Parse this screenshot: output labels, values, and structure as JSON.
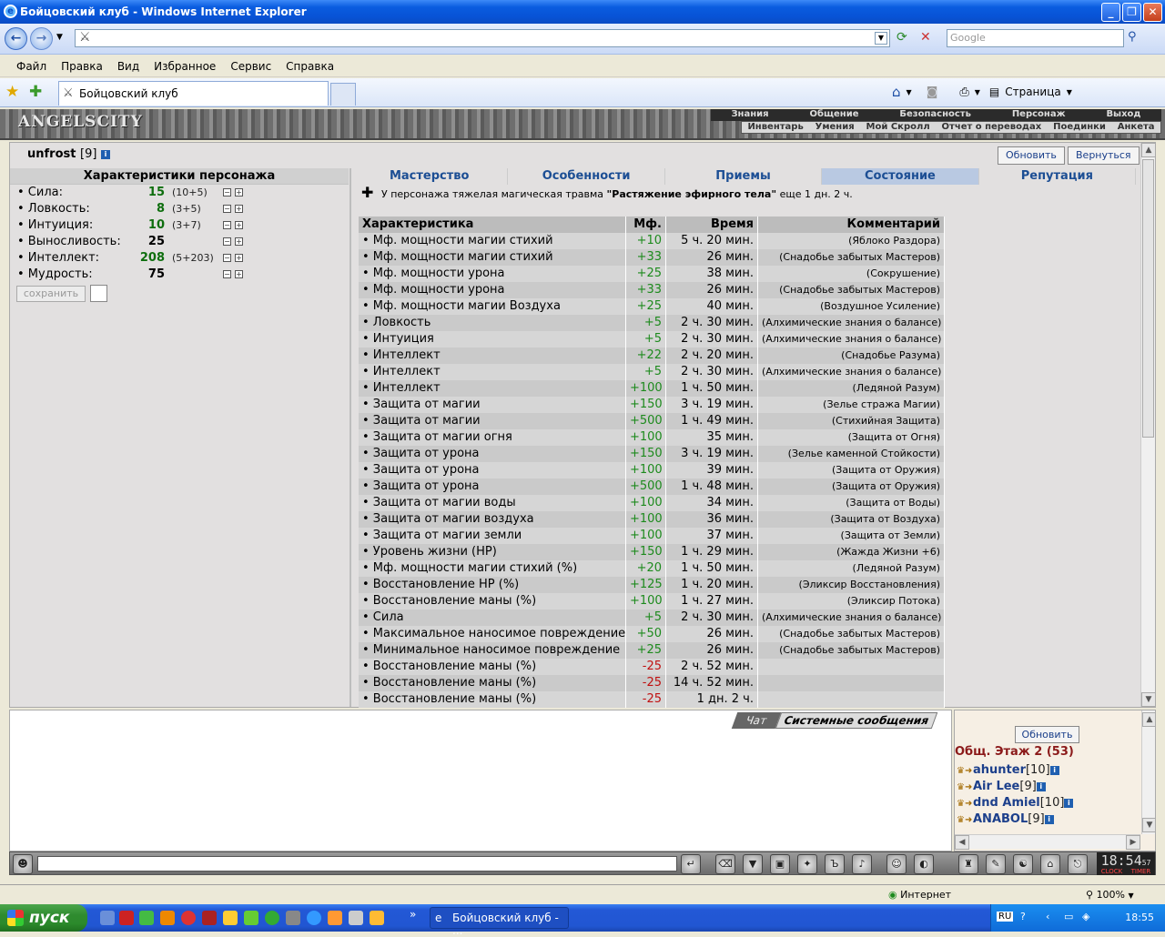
{
  "window": {
    "title": "Бойцовский клуб - Windows Internet Explorer"
  },
  "search": {
    "placeholder": "Google"
  },
  "menu": [
    "Файл",
    "Правка",
    "Вид",
    "Избранное",
    "Сервис",
    "Справка"
  ],
  "tab": {
    "title": "Бойцовский клуб",
    "page_label": "Страница"
  },
  "site": {
    "logo": "ANGELSCITY",
    "topnav": [
      "Знания",
      "Общение",
      "Безопасность",
      "Персонаж",
      "Выход"
    ],
    "subnav": [
      "Инвентарь",
      "Умения",
      "Мой Скролл",
      "Отчет о переводах",
      "Поединки",
      "Анкета"
    ]
  },
  "character": {
    "name": "unfrost",
    "level": "[9]"
  },
  "buttons": {
    "refresh": "Обновить",
    "back": "Вернуться",
    "save": "сохранить",
    "roster_refresh": "Обновить"
  },
  "stats": {
    "title": "Характеристики персонажа",
    "items": [
      {
        "name": "• Сила:",
        "value": "15",
        "base": "(10+5)",
        "green": true
      },
      {
        "name": "• Ловкость:",
        "value": "8",
        "base": "(3+5)",
        "green": true
      },
      {
        "name": "• Интуиция:",
        "value": "10",
        "base": "(3+7)",
        "green": true
      },
      {
        "name": "• Выносливость:",
        "value": "25",
        "base": "",
        "green": false
      },
      {
        "name": "• Интеллект:",
        "value": "208",
        "base": "(5+203)",
        "green": true
      },
      {
        "name": "• Мудрость:",
        "value": "75",
        "base": "",
        "green": false
      }
    ]
  },
  "tabs": [
    "Мастерство",
    "Особенности",
    "Приемы",
    "Состояние",
    "Репутация"
  ],
  "injury": {
    "prefix": "У персонажа тяжелая магическая травма ",
    "name": "\"Растяжение эфирного тела\"",
    "suffix": " еще 1 дн. 2 ч."
  },
  "effects": {
    "headers": [
      "Характеристика",
      "Мф.",
      "Время",
      "Комментарий"
    ],
    "rows": [
      [
        "• Мф. мощности магии стихий",
        "+10",
        "5 ч. 20 мин.",
        "(Яблоко Раздора)"
      ],
      [
        "• Мф. мощности магии стихий",
        "+33",
        "26 мин.",
        "(Снадобье забытых Мастеров)"
      ],
      [
        "• Мф. мощности урона",
        "+25",
        "38 мин.",
        "(Сокрушение)"
      ],
      [
        "• Мф. мощности урона",
        "+33",
        "26 мин.",
        "(Снадобье забытых Мастеров)"
      ],
      [
        "• Мф. мощности магии Воздуха",
        "+25",
        "40 мин.",
        "(Воздушное Усиление)"
      ],
      [
        "• Ловкость",
        "+5",
        "2 ч. 30 мин.",
        "(Алхимические знания о балансе)"
      ],
      [
        "• Интуиция",
        "+5",
        "2 ч. 30 мин.",
        "(Алхимические знания о балансе)"
      ],
      [
        "• Интеллект",
        "+22",
        "2 ч. 20 мин.",
        "(Снадобье Разума)"
      ],
      [
        "• Интеллект",
        "+5",
        "2 ч. 30 мин.",
        "(Алхимические знания о балансе)"
      ],
      [
        "• Интеллект",
        "+100",
        "1 ч. 50 мин.",
        "(Ледяной Разум)"
      ],
      [
        "• Защита от магии",
        "+150",
        "3 ч. 19 мин.",
        "(Зелье стража Магии)"
      ],
      [
        "• Защита от магии",
        "+500",
        "1 ч. 49 мин.",
        "(Стихийная Защита)"
      ],
      [
        "• Защита от магии огня",
        "+100",
        "35 мин.",
        "(Защита от Огня)"
      ],
      [
        "• Защита от урона",
        "+150",
        "3 ч. 19 мин.",
        "(Зелье каменной Стойкости)"
      ],
      [
        "• Защита от урона",
        "+100",
        "39 мин.",
        "(Защита от Оружия)"
      ],
      [
        "• Защита от урона",
        "+500",
        "1 ч. 48 мин.",
        "(Защита от Оружия)"
      ],
      [
        "• Защита от магии воды",
        "+100",
        "34 мин.",
        "(Защита от Воды)"
      ],
      [
        "• Защита от магии воздуха",
        "+100",
        "36 мин.",
        "(Защита от Воздуха)"
      ],
      [
        "• Защита от магии земли",
        "+100",
        "37 мин.",
        "(Защита от Земли)"
      ],
      [
        "• Уровень жизни (HP)",
        "+150",
        "1 ч. 29 мин.",
        "(Жажда Жизни +6)"
      ],
      [
        "• Мф. мощности магии стихий (%)",
        "+20",
        "1 ч. 50 мин.",
        "(Ледяной Разум)"
      ],
      [
        "• Восстановление HP (%)",
        "+125",
        "1 ч. 20 мин.",
        "(Эликсир Восстановления)"
      ],
      [
        "• Восстановление маны (%)",
        "+100",
        "1 ч. 27 мин.",
        "(Эликсир Потока)"
      ],
      [
        "• Сила",
        "+5",
        "2 ч. 30 мин.",
        "(Алхимические знания о балансе)"
      ],
      [
        "• Максимальное наносимое повреждение",
        "+50",
        "26 мин.",
        "(Снадобье забытых Мастеров)"
      ],
      [
        "• Минимальное наносимое повреждение",
        "+25",
        "26 мин.",
        "(Снадобье забытых Мастеров)"
      ],
      [
        "• Восстановление маны (%)",
        "-25",
        "2 ч. 52 мин.",
        ""
      ],
      [
        "• Восстановление маны (%)",
        "-25",
        "14 ч. 52 мин.",
        ""
      ],
      [
        "• Восстановление маны (%)",
        "-25",
        "1 дн. 2 ч.",
        ""
      ]
    ]
  },
  "chat": {
    "tab_chat": "Чат",
    "tab_system": "Системные сообщения"
  },
  "roster": {
    "floor": "Общ. Этаж 2 (53)",
    "players": [
      {
        "name": "ahunter",
        "level": "[10]"
      },
      {
        "name": "Air Lee",
        "level": "[9]"
      },
      {
        "name": "dnd Amiel",
        "level": "[10]"
      },
      {
        "name": "ANABOL",
        "level": "[9]"
      }
    ]
  },
  "clock": {
    "time": "18:54",
    "seconds": "57",
    "label_clock": "CLOCK",
    "label_timer": "TIMER"
  },
  "status": {
    "zone": "Интернет",
    "zoom": "100%"
  },
  "taskbar": {
    "start": "пуск",
    "item": "Бойцовский клуб - ...",
    "lang": "RU",
    "time": "18:55"
  }
}
